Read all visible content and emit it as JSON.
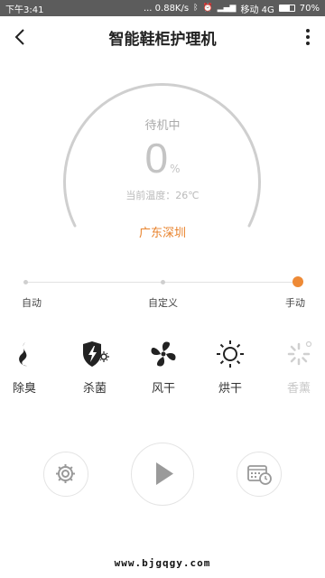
{
  "status_bar": {
    "time": "下午3:41",
    "speed": "... 0.88K/s",
    "carrier": "移动 4G",
    "battery": "70%",
    "battery_level": 0.7
  },
  "header": {
    "title": "智能鞋柜护理机",
    "back_icon": "chevron-left-icon",
    "more_icon": "more-vertical-icon"
  },
  "gauge": {
    "state": "待机中",
    "percent_value": "0",
    "percent_unit": "%",
    "progress": 0,
    "temperature": "当前温度：26℃",
    "location": "广东深圳",
    "location_color": "#e8822b"
  },
  "mode_slider": {
    "options": [
      "自动",
      "自定义",
      "手动"
    ],
    "selected_index": 2,
    "accent_color": "#ee8a36"
  },
  "functions": [
    {
      "label": "除臭",
      "icon": "deodorize-flame-icon",
      "enabled": true
    },
    {
      "label": "杀菌",
      "icon": "sterilize-shield-icon",
      "enabled": true
    },
    {
      "label": "风干",
      "icon": "fan-icon",
      "enabled": true
    },
    {
      "label": "烘干",
      "icon": "sun-icon",
      "enabled": true
    },
    {
      "label": "香薰",
      "icon": "aroma-icon",
      "enabled": false
    }
  ],
  "controls": {
    "settings_icon": "settings-gear-icon",
    "play_icon": "play-icon",
    "schedule_icon": "schedule-calendar-icon"
  },
  "watermark": "www.bjgqgy.com"
}
